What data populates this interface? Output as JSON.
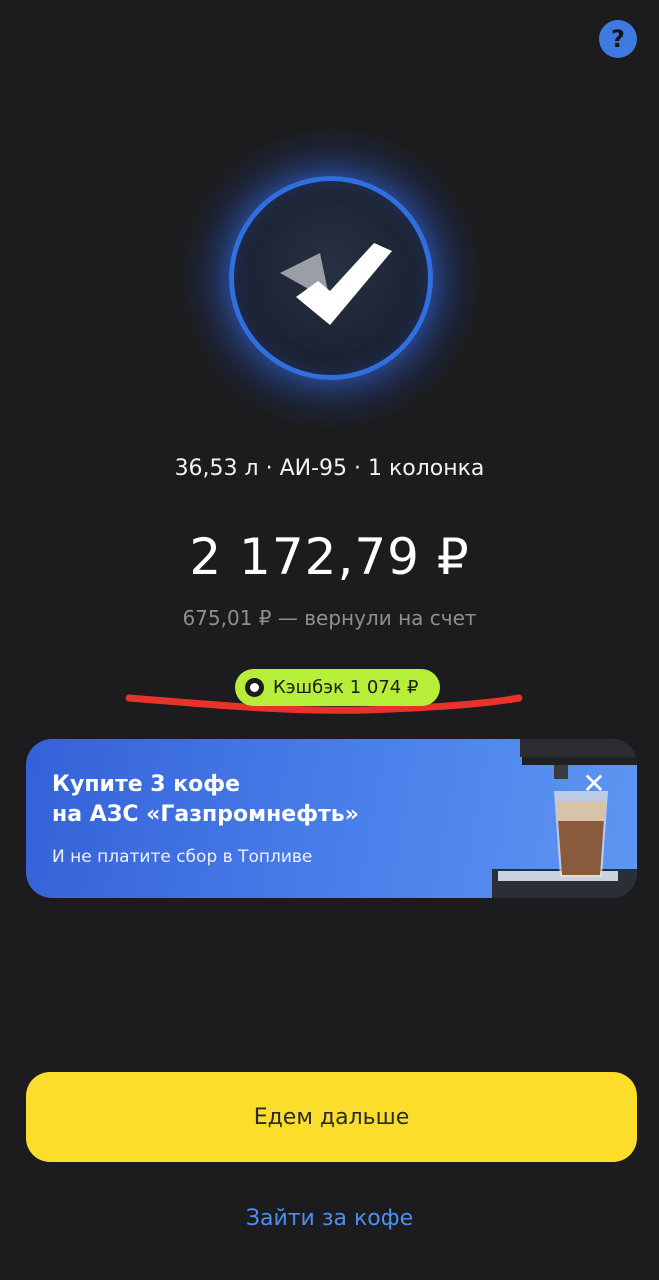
{
  "header": {
    "help_label": "?"
  },
  "status": {
    "icon": "checkmark-icon"
  },
  "fuel_info": "36,53 л · АИ-95 · 1 колонка",
  "amount": "2 172,79 ₽",
  "refund": "675,01 ₽ — вернули на счет",
  "cashback": {
    "label": "Кэшбэк 1 074 ₽"
  },
  "promo": {
    "title": "Купите 3 кофе\nна АЗС «Газпромнефть»",
    "subtitle": "И не платите сбор в Топливе",
    "close_label": "✕"
  },
  "actions": {
    "primary_label": "Едем дальше",
    "secondary_label": "Зайти за кофе"
  },
  "colors": {
    "background": "#1c1c1e",
    "accent_blue": "#3d7be0",
    "cashback_green": "#b6ee3a",
    "primary_yellow": "#fcdd2c",
    "annotation_red": "#e8322c"
  }
}
